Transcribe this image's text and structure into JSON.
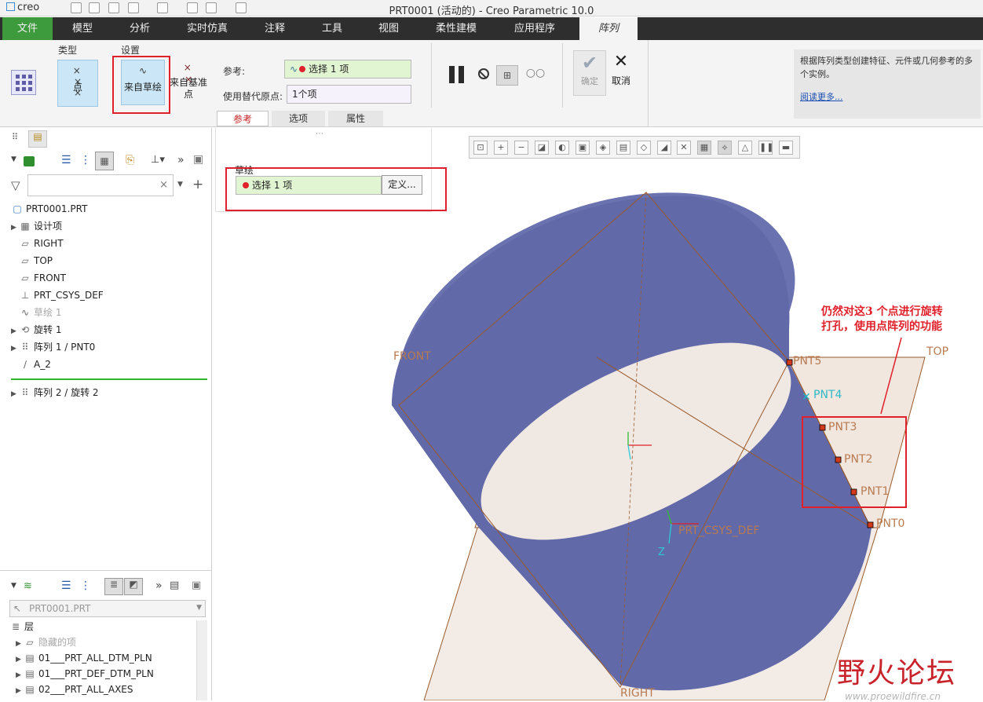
{
  "window": {
    "app": "creo",
    "title": "PRT0001 (活动的) - Creo Parametric 10.0"
  },
  "menu": [
    "文件",
    "模型",
    "分析",
    "实时仿真",
    "注释",
    "工具",
    "视图",
    "柔性建模",
    "应用程序",
    "阵列"
  ],
  "ribbon": {
    "group_type": "类型",
    "group_settings": "设置",
    "btn_point": "点",
    "btn_from_sketch": "来自草绘",
    "btn_from_datum_1": "来自基准",
    "btn_from_datum_2": "点",
    "ref_label": "参考:",
    "ref_value": "选择 1 项",
    "alt_origin_label": "使用替代原点:",
    "alt_origin_value": "1个项",
    "ok": "确定",
    "cancel": "取消"
  },
  "subtabs": [
    "参考",
    "选项",
    "属性"
  ],
  "ref_panel": {
    "label": "草绘",
    "value": "选择 1 项",
    "define": "定义..."
  },
  "help": {
    "text": "根据阵列类型创建特征、元件或几何参考的多个实例。",
    "link": "阅读更多..."
  },
  "model_tree": {
    "root": "PRT0001.PRT",
    "items": [
      {
        "label": "设计项",
        "icon": "list-icon",
        "arrow": true,
        "dim": false
      },
      {
        "label": "RIGHT",
        "icon": "datum-plane-icon",
        "arrow": false,
        "dim": false
      },
      {
        "label": "TOP",
        "icon": "datum-plane-icon",
        "arrow": false,
        "dim": false
      },
      {
        "label": "FRONT",
        "icon": "datum-plane-icon",
        "arrow": false,
        "dim": false
      },
      {
        "label": "PRT_CSYS_DEF",
        "icon": "csys-icon",
        "arrow": false,
        "dim": false
      },
      {
        "label": "草绘 1",
        "icon": "sketch-icon",
        "arrow": false,
        "dim": true
      },
      {
        "label": "旋转 1",
        "icon": "revolve-icon",
        "arrow": true,
        "dim": false
      },
      {
        "label": "阵列 1 / PNT0",
        "icon": "pattern-icon",
        "arrow": true,
        "dim": false
      },
      {
        "label": "A_2",
        "icon": "axis-icon",
        "arrow": false,
        "dim": false
      },
      {
        "label": "阵列 2 / 旋转 2",
        "icon": "pattern-icon",
        "arrow": true,
        "dim": false
      }
    ]
  },
  "layer_tree": {
    "selector": "PRT0001.PRT",
    "heading": "层",
    "items": [
      {
        "label": "隐藏的项",
        "dim": true
      },
      {
        "label": "01___PRT_ALL_DTM_PLN",
        "dim": false
      },
      {
        "label": "01___PRT_DEF_DTM_PLN",
        "dim": false
      },
      {
        "label": "02___PRT_ALL_AXES",
        "dim": false
      }
    ]
  },
  "viewport": {
    "annotation_line1": "仍然对这3 个点进行旋转",
    "annotation_line2": "打孔，使用点阵列的功能",
    "labels": {
      "front": "FRONT",
      "top": "TOP",
      "right": "RIGHT",
      "csys": "PRT_CSYS_DEF",
      "z": "Z"
    },
    "points": [
      "PNT5",
      "PNT4",
      "PNT3",
      "PNT2",
      "PNT1",
      "PNT0"
    ]
  },
  "watermark": {
    "title": "野火论坛",
    "url": "www.proewildfire.cn"
  },
  "colors": {
    "menu_bg": "#2e2e2e",
    "file_tab": "#3d9a3d",
    "ribbon_btn": "#cbe7f7",
    "ref_green": "#e2f5d2",
    "annotation": "#e0202a",
    "cylinder": "#5e66a3"
  }
}
